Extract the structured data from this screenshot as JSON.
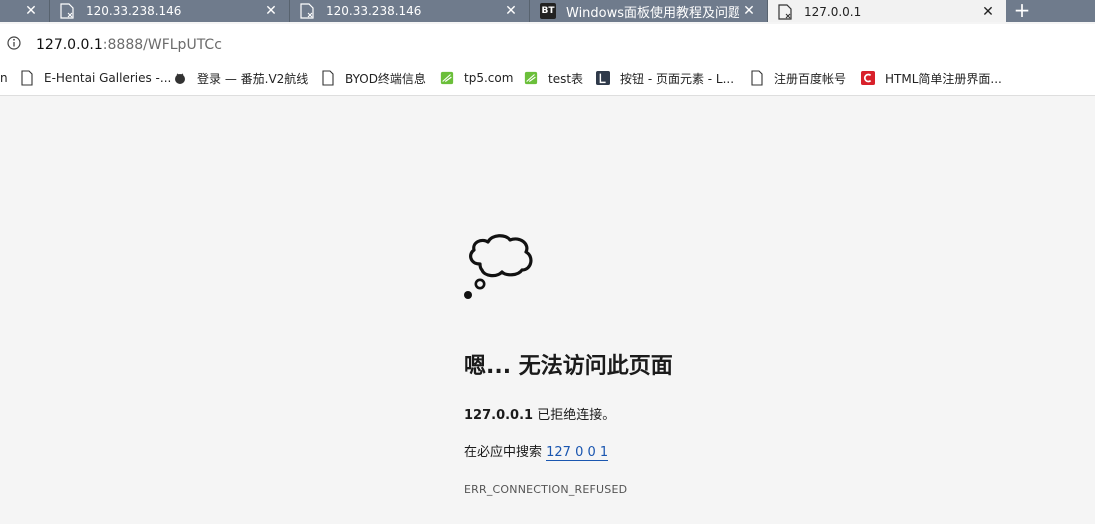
{
  "tabs": [
    {
      "title": "",
      "close": "✕"
    },
    {
      "title": "120.33.238.146",
      "close": "✕"
    },
    {
      "title": "120.33.238.146",
      "close": "✕"
    },
    {
      "title": "Windows面板使用教程及问题汇总",
      "icon_text": "BT",
      "close": "✕"
    },
    {
      "title": "127.0.0.1",
      "close": "✕",
      "active": true
    }
  ],
  "new_tab": "+",
  "address": {
    "host": "127.0.0.1",
    "rest": ":8888/WFLpUTCc"
  },
  "bookmarks": [
    {
      "label": "n",
      "icon": ""
    },
    {
      "label": "E-Hentai Galleries -...",
      "icon": "page-icon"
    },
    {
      "label": "登录 — 番茄.V2航线",
      "icon": "tomato-icon"
    },
    {
      "label": "BYOD终端信息",
      "icon": "page-icon"
    },
    {
      "label": "tp5.com",
      "icon": "leaf-icon"
    },
    {
      "label": "test表",
      "icon": "leaf-icon"
    },
    {
      "label": "按钮 - 页面元素 - L...",
      "icon": "layui-icon"
    },
    {
      "label": "注册百度帐号",
      "icon": "page-icon"
    },
    {
      "label": "HTML简单注册界面...",
      "icon": "c-icon"
    }
  ],
  "error": {
    "title": "嗯... 无法访问此页面",
    "host_bold": "127.0.0.1",
    "refused_text": " 已拒绝连接。",
    "search_prefix": "在必应中搜索 ",
    "search_link": "127 0 0 1",
    "code": "ERR_CONNECTION_REFUSED"
  },
  "colors": {
    "tabstrip": "#6f7b8c",
    "page_bg": "#f5f5f5",
    "link": "#1a56b0"
  }
}
